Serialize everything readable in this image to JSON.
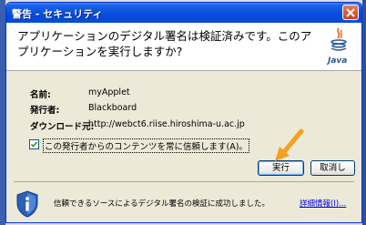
{
  "window": {
    "title": "警告 - セキュリティ"
  },
  "header": {
    "message": "アプリケーションのデジタル署名は検証済みです。このアプリケーションを実行しますか?",
    "logo_text": "Java"
  },
  "fields": [
    {
      "label": "名前:",
      "value": "myApplet"
    },
    {
      "label": "発行者:",
      "value": "Blackboard"
    },
    {
      "label": "ダウンロード元:",
      "value": "http://webct6.riise.hiroshima-u.ac.jp"
    }
  ],
  "checkbox": {
    "label": "この発行者からのコンテンツを常に信頼します(A)。",
    "checked": true
  },
  "buttons": {
    "run": "実行",
    "cancel": "取消し"
  },
  "footer": {
    "message": "信頼できるソースによるデジタル署名の検証に成功しました。",
    "more_info": "詳細情報(I)..."
  },
  "colors": {
    "titlebar": "#0a53e0",
    "link": "#0000ee",
    "arrow": "#f5a01e"
  },
  "icons": {
    "close": "close-icon",
    "java": "java-logo-icon",
    "shield": "shield-info-icon",
    "check": "checkmark-icon",
    "arrow": "arrow-pointer-icon"
  }
}
